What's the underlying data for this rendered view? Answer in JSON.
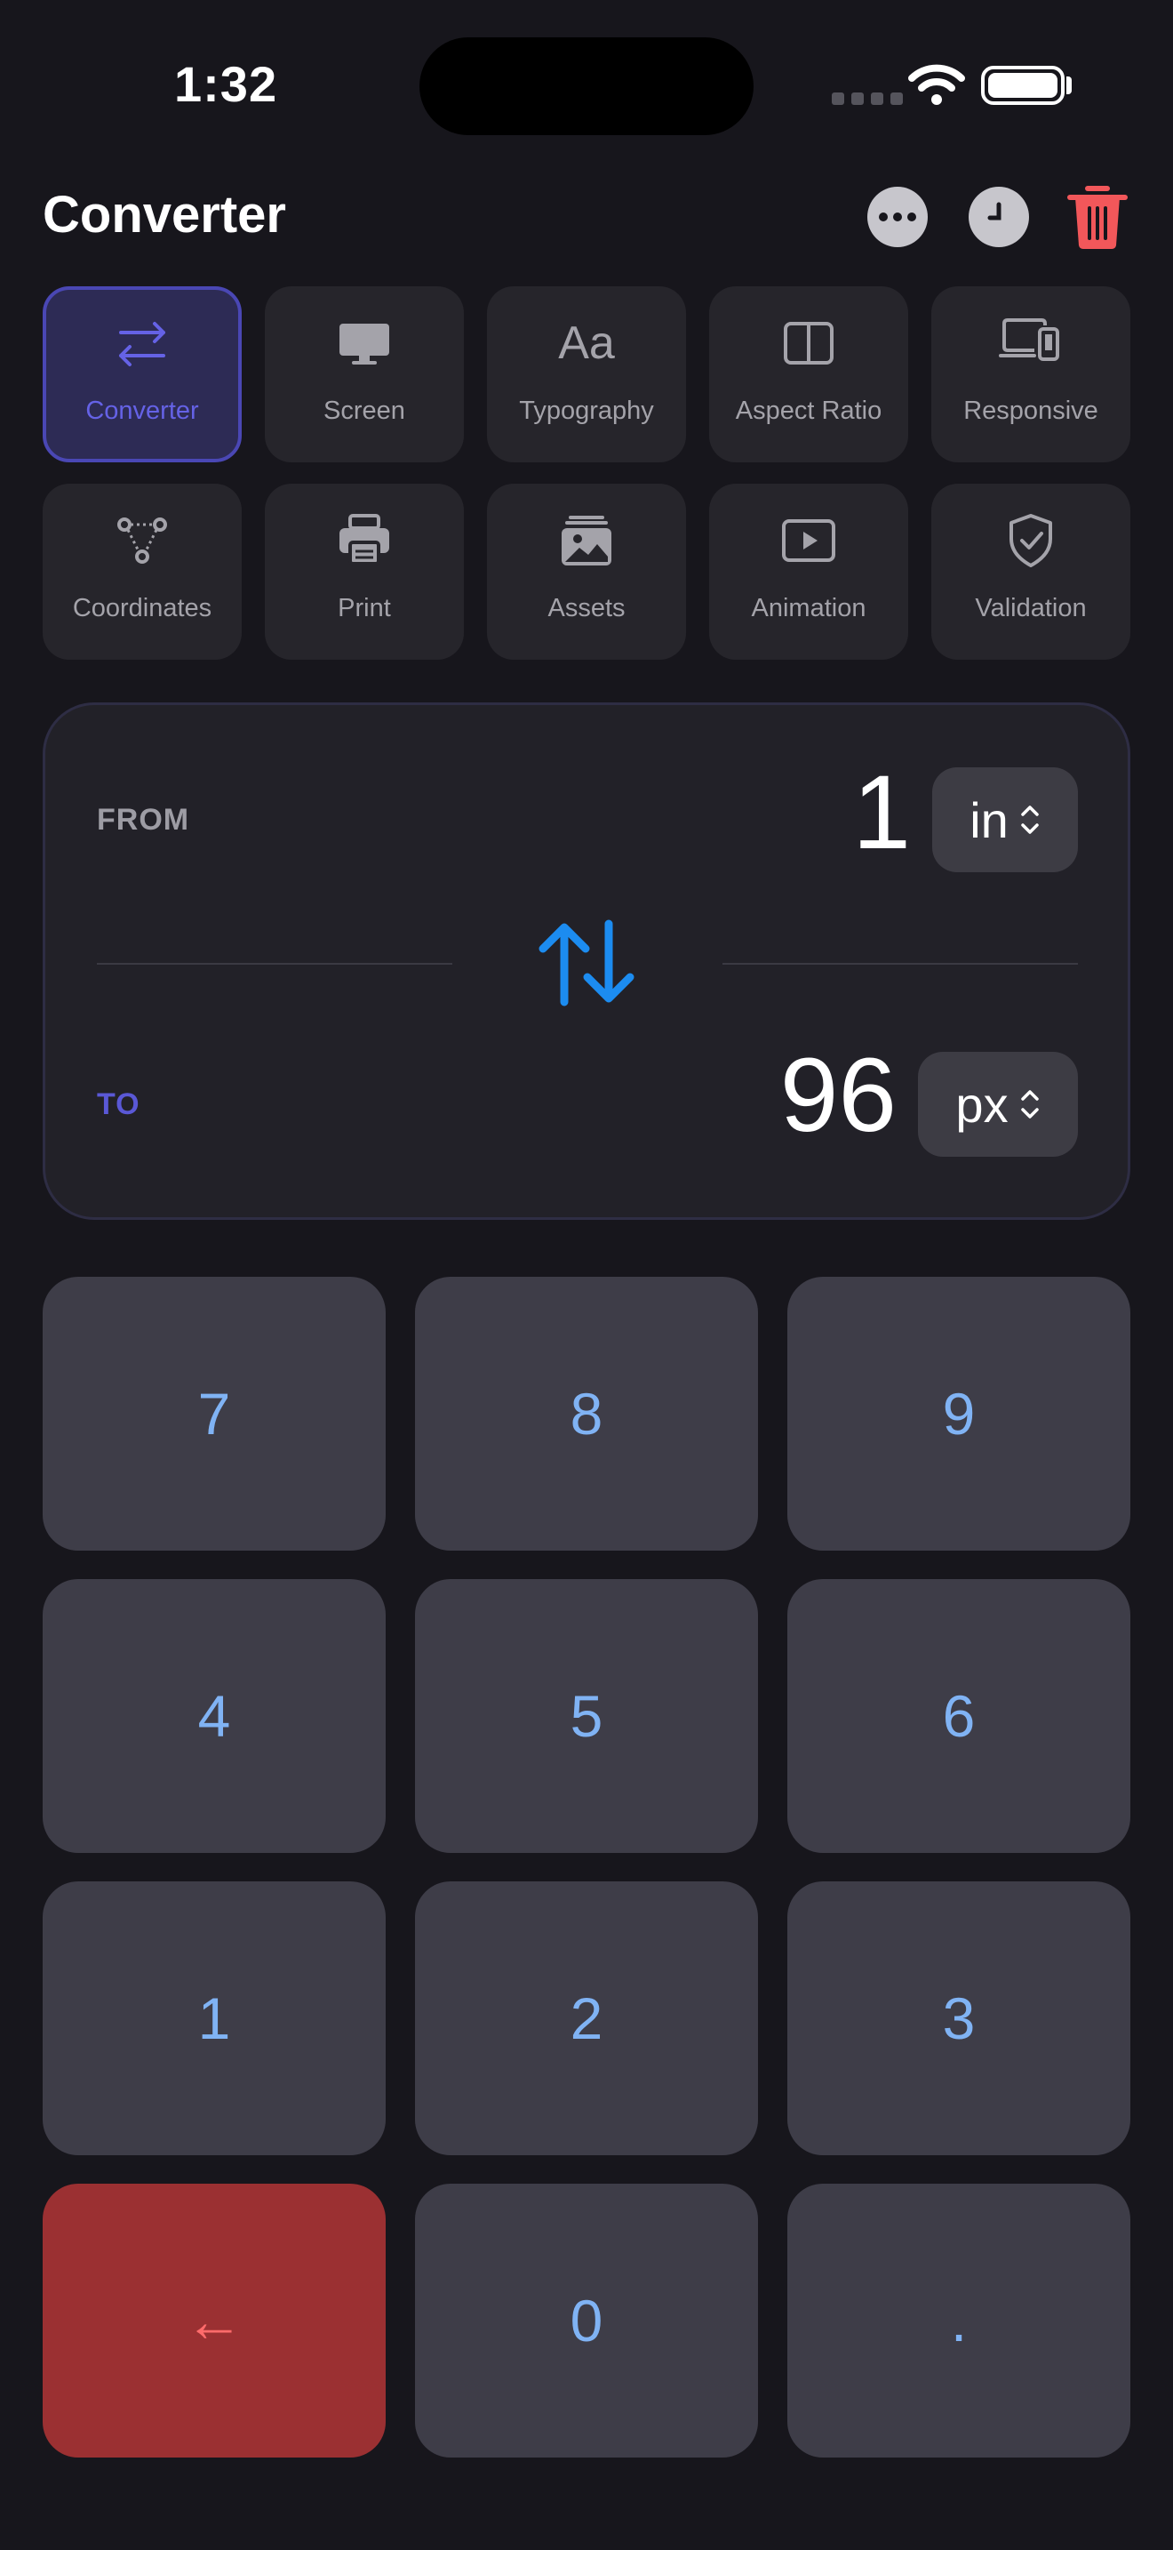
{
  "status": {
    "time": "1:32"
  },
  "header": {
    "title": "Converter"
  },
  "tools": [
    {
      "label": "Converter",
      "icon": "arrows-left-right-icon",
      "active": true
    },
    {
      "label": "Screen",
      "icon": "monitor-icon"
    },
    {
      "label": "Typography",
      "icon": "Aa",
      "icon_name": "typography-icon"
    },
    {
      "label": "Aspect Ratio",
      "icon": "aspect-ratio-icon"
    },
    {
      "label": "Responsive",
      "icon": "devices-icon"
    },
    {
      "label": "Coordinates",
      "icon": "coordinates-icon"
    },
    {
      "label": "Print",
      "icon": "printer-icon"
    },
    {
      "label": "Assets",
      "icon": "photo-stack-icon"
    },
    {
      "label": "Animation",
      "icon": "play-icon"
    },
    {
      "label": "Validation",
      "icon": "shield-check-icon"
    }
  ],
  "converter": {
    "from_label": "FROM",
    "from_value": "1",
    "from_unit": "in",
    "to_label": "TO",
    "to_value": "96",
    "to_unit": "px"
  },
  "keypad": {
    "keys": [
      "7",
      "8",
      "9",
      "4",
      "5",
      "6",
      "1",
      "2",
      "3",
      "←",
      "0",
      "."
    ]
  },
  "colors": {
    "background": "#17161c",
    "accent": "#6562e6",
    "swap_blue": "#1c8cf0",
    "key_digit": "#80b3f4",
    "delete_red": "#9b3032",
    "trash_red": "#f2575a"
  }
}
